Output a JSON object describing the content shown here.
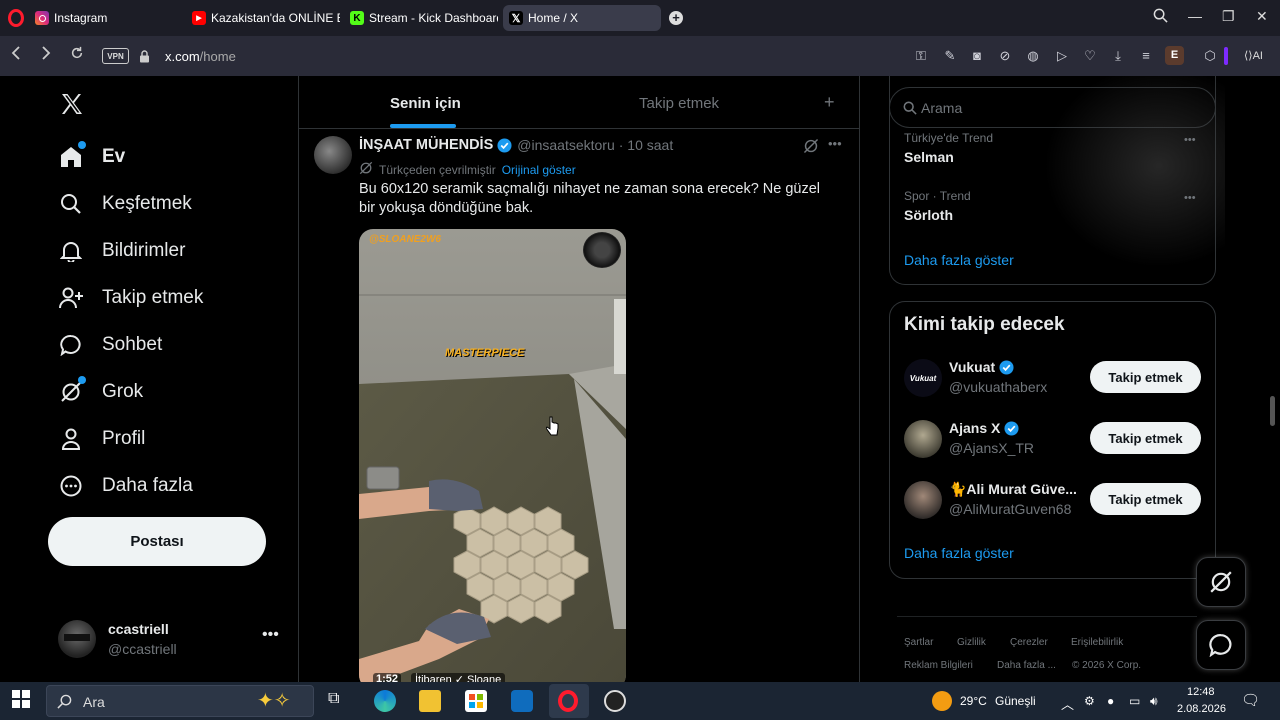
{
  "browser": {
    "tabs": [
      {
        "label": "Instagram",
        "icon": "instagram-icon"
      },
      {
        "label": "Kazakistan'da ONLİNE EVİ",
        "icon": "youtube-icon"
      },
      {
        "label": "Stream - Kick Dashboard",
        "icon": "kick-icon"
      },
      {
        "label": "Home / X",
        "icon": "x-icon"
      }
    ],
    "vpn_label": "VPN",
    "url_host": "x.com",
    "url_path": "/home",
    "ai_label": "AI",
    "ext_label": "E"
  },
  "nav": {
    "items": [
      {
        "label": "Ev",
        "icon": "home-icon"
      },
      {
        "label": "Keşfetmek",
        "icon": "search-icon"
      },
      {
        "label": "Bildirimler",
        "icon": "bell-icon"
      },
      {
        "label": "Takip etmek",
        "icon": "follow-icon"
      },
      {
        "label": "Sohbet",
        "icon": "chat-icon"
      },
      {
        "label": "Grok",
        "icon": "grok-icon"
      },
      {
        "label": "Profil",
        "icon": "person-icon"
      },
      {
        "label": "Daha fazla",
        "icon": "more-circle-icon"
      }
    ],
    "post_label": "Postası",
    "account_name": "ccastriell",
    "account_handle": "@ccastriell"
  },
  "feed": {
    "tab_for_you": "Senin için",
    "tab_following": "Takip etmek",
    "tweet": {
      "author": "İNŞAAT MÜHENDİS",
      "handle": "@insaatsektoru",
      "time": "· 10 saat",
      "translated_note": "Türkçeden çevrilmiştir",
      "show_original": "Orijinal göster",
      "text": "Bu 60x120 seramik saçmalığı nihayet ne zaman sona erecek? Ne güzel bir yokuşa döndüğüne bak.",
      "media_watermark": "@SLOANE2W6",
      "media_caption": "MASTERPIECE",
      "media_time": "1:52",
      "media_credit": "İtibaren ✓ Sloane"
    }
  },
  "sidebar": {
    "search_placeholder": "Arama",
    "trends": [
      {
        "category": "Türkiye'de Trend",
        "name": "Selman"
      },
      {
        "category": "Spor · Trend",
        "name": "Sörloth"
      }
    ],
    "show_more": "Daha fazla göster",
    "who_to_follow_title": "Kimi takip edecek",
    "accounts": [
      {
        "name": "Vukuat",
        "handle": "@vukuathaberx",
        "verified": true,
        "avatar_text": "Vukuat"
      },
      {
        "name": "Ajans X",
        "handle": "@AjansX_TR",
        "verified": true,
        "avatar_text": ""
      },
      {
        "name": "🐈Ali Murat Güve...",
        "handle": "@AliMuratGuven68",
        "verified": false,
        "avatar_text": ""
      }
    ],
    "follow_label": "Takip etmek",
    "show_more_2": "Daha fazla göster",
    "footer": [
      "Şartlar",
      "Gizlilik",
      "Çerezler",
      "Erişilebilirlik",
      "Reklam Bilgileri",
      "Daha fazla ...",
      "© 2026 X Corp."
    ]
  },
  "taskbar": {
    "search_placeholder": "Ara",
    "weather_temp": "29°C",
    "weather_desc": "Güneşli",
    "time": "12:48",
    "date": "2.08.2026"
  },
  "colors": {
    "accent": "#1d9bf0",
    "background": "#000000",
    "chrome": "#2a2b38"
  }
}
